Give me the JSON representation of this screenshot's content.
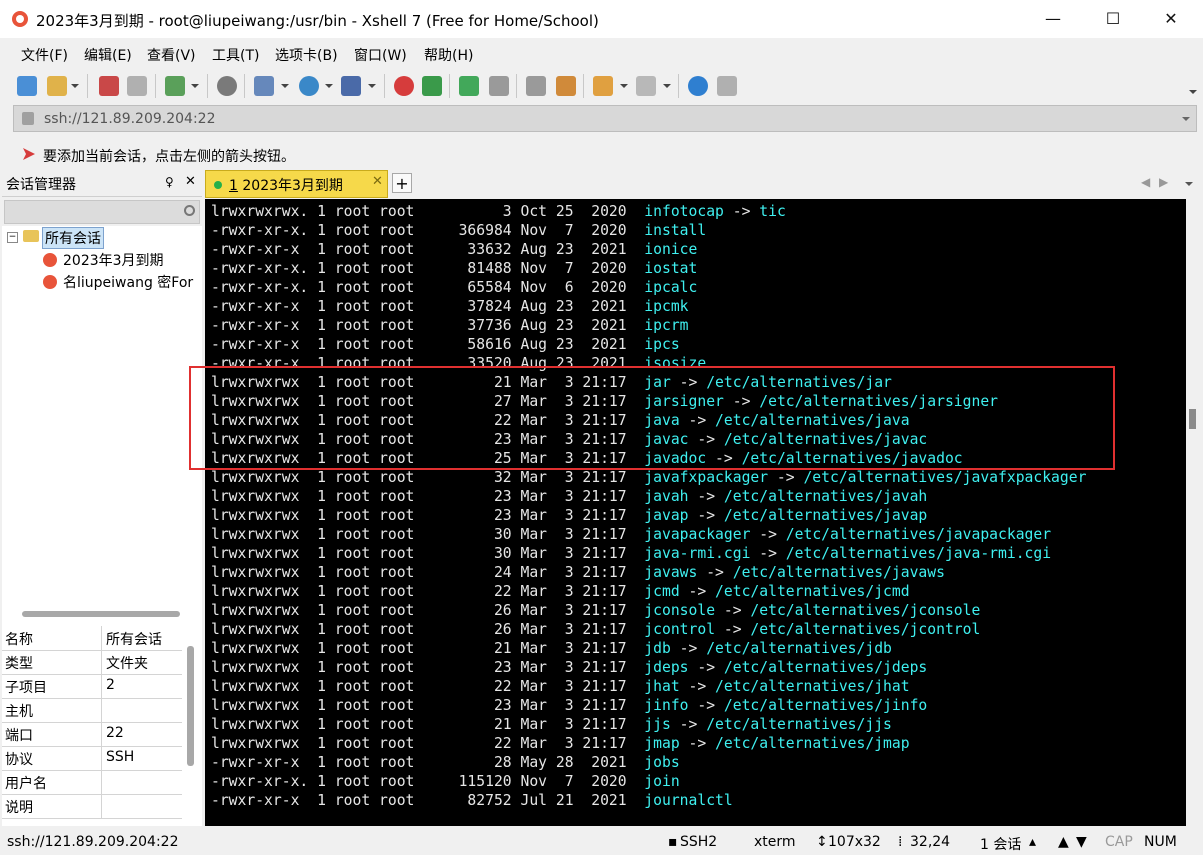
{
  "window": {
    "title": "2023年3月到期 - root@liupeiwang:/usr/bin - Xshell 7 (Free for Home/School)",
    "minimize": "—",
    "maximize": "☐",
    "close": "✕"
  },
  "menu": [
    "文件(F)",
    "编辑(E)",
    "查看(V)",
    "工具(T)",
    "选项卡(B)",
    "窗口(W)",
    "帮助(H)"
  ],
  "address": {
    "value": "ssh://121.89.209.204:22"
  },
  "hint": {
    "text": "要添加当前会话，点击左侧的箭头按钮。"
  },
  "sidebar": {
    "title": "会话管理器",
    "pin": "♀",
    "close": "✕",
    "tree": {
      "root": "所有会话",
      "items": [
        "2023年3月到期",
        "名liupeiwang 密For"
      ]
    },
    "properties": [
      {
        "key": "名称",
        "value": "所有会话"
      },
      {
        "key": "类型",
        "value": "文件夹"
      },
      {
        "key": "子项目",
        "value": "2"
      },
      {
        "key": "主机",
        "value": ""
      },
      {
        "key": "端口",
        "value": "22"
      },
      {
        "key": "协议",
        "value": "SSH"
      },
      {
        "key": "用户名",
        "value": ""
      },
      {
        "key": "说明",
        "value": ""
      }
    ]
  },
  "tabs": [
    {
      "number": "1",
      "label": "2023年3月到期",
      "close": "✕"
    }
  ],
  "terminal": {
    "lines": [
      {
        "perm": "lrwxrwxrwx.",
        "links": "1",
        "owner": "root",
        "group": "root",
        "size": "3",
        "month": "Oct",
        "day": "25",
        "time": " 2020",
        "name": "infotocap",
        "target": "tic"
      },
      {
        "perm": "-rwxr-xr-x.",
        "links": "1",
        "owner": "root",
        "group": "root",
        "size": "366984",
        "month": "Nov",
        "day": "7",
        "time": " 2020",
        "name": "install",
        "target": ""
      },
      {
        "perm": "-rwxr-xr-x ",
        "links": "1",
        "owner": "root",
        "group": "root",
        "size": "33632",
        "month": "Aug",
        "day": "23",
        "time": " 2021",
        "name": "ionice",
        "target": ""
      },
      {
        "perm": "-rwxr-xr-x.",
        "links": "1",
        "owner": "root",
        "group": "root",
        "size": "81488",
        "month": "Nov",
        "day": "7",
        "time": " 2020",
        "name": "iostat",
        "target": ""
      },
      {
        "perm": "-rwxr-xr-x.",
        "links": "1",
        "owner": "root",
        "group": "root",
        "size": "65584",
        "month": "Nov",
        "day": "6",
        "time": " 2020",
        "name": "ipcalc",
        "target": ""
      },
      {
        "perm": "-rwxr-xr-x ",
        "links": "1",
        "owner": "root",
        "group": "root",
        "size": "37824",
        "month": "Aug",
        "day": "23",
        "time": " 2021",
        "name": "ipcmk",
        "target": ""
      },
      {
        "perm": "-rwxr-xr-x ",
        "links": "1",
        "owner": "root",
        "group": "root",
        "size": "37736",
        "month": "Aug",
        "day": "23",
        "time": " 2021",
        "name": "ipcrm",
        "target": ""
      },
      {
        "perm": "-rwxr-xr-x ",
        "links": "1",
        "owner": "root",
        "group": "root",
        "size": "58616",
        "month": "Aug",
        "day": "23",
        "time": " 2021",
        "name": "ipcs",
        "target": ""
      },
      {
        "perm": "-rwxr-xr-x ",
        "links": "1",
        "owner": "root",
        "group": "root",
        "size": "33520",
        "month": "Aug",
        "day": "23",
        "time": " 2021",
        "name": "isosize",
        "target": ""
      },
      {
        "perm": "lrwxrwxrwx ",
        "links": "1",
        "owner": "root",
        "group": "root",
        "size": "21",
        "month": "Mar",
        "day": "3",
        "time": "21:17",
        "name": "jar",
        "target": "/etc/alternatives/jar"
      },
      {
        "perm": "lrwxrwxrwx ",
        "links": "1",
        "owner": "root",
        "group": "root",
        "size": "27",
        "month": "Mar",
        "day": "3",
        "time": "21:17",
        "name": "jarsigner",
        "target": "/etc/alternatives/jarsigner"
      },
      {
        "perm": "lrwxrwxrwx ",
        "links": "1",
        "owner": "root",
        "group": "root",
        "size": "22",
        "month": "Mar",
        "day": "3",
        "time": "21:17",
        "name": "java",
        "target": "/etc/alternatives/java"
      },
      {
        "perm": "lrwxrwxrwx ",
        "links": "1",
        "owner": "root",
        "group": "root",
        "size": "23",
        "month": "Mar",
        "day": "3",
        "time": "21:17",
        "name": "javac",
        "target": "/etc/alternatives/javac"
      },
      {
        "perm": "lrwxrwxrwx ",
        "links": "1",
        "owner": "root",
        "group": "root",
        "size": "25",
        "month": "Mar",
        "day": "3",
        "time": "21:17",
        "name": "javadoc",
        "target": "/etc/alternatives/javadoc"
      },
      {
        "perm": "lrwxrwxrwx ",
        "links": "1",
        "owner": "root",
        "group": "root",
        "size": "32",
        "month": "Mar",
        "day": "3",
        "time": "21:17",
        "name": "javafxpackager",
        "target": "/etc/alternatives/javafxpackager"
      },
      {
        "perm": "lrwxrwxrwx ",
        "links": "1",
        "owner": "root",
        "group": "root",
        "size": "23",
        "month": "Mar",
        "day": "3",
        "time": "21:17",
        "name": "javah",
        "target": "/etc/alternatives/javah"
      },
      {
        "perm": "lrwxrwxrwx ",
        "links": "1",
        "owner": "root",
        "group": "root",
        "size": "23",
        "month": "Mar",
        "day": "3",
        "time": "21:17",
        "name": "javap",
        "target": "/etc/alternatives/javap"
      },
      {
        "perm": "lrwxrwxrwx ",
        "links": "1",
        "owner": "root",
        "group": "root",
        "size": "30",
        "month": "Mar",
        "day": "3",
        "time": "21:17",
        "name": "javapackager",
        "target": "/etc/alternatives/javapackager"
      },
      {
        "perm": "lrwxrwxrwx ",
        "links": "1",
        "owner": "root",
        "group": "root",
        "size": "30",
        "month": "Mar",
        "day": "3",
        "time": "21:17",
        "name": "java-rmi.cgi",
        "target": "/etc/alternatives/java-rmi.cgi"
      },
      {
        "perm": "lrwxrwxrwx ",
        "links": "1",
        "owner": "root",
        "group": "root",
        "size": "24",
        "month": "Mar",
        "day": "3",
        "time": "21:17",
        "name": "javaws",
        "target": "/etc/alternatives/javaws"
      },
      {
        "perm": "lrwxrwxrwx ",
        "links": "1",
        "owner": "root",
        "group": "root",
        "size": "22",
        "month": "Mar",
        "day": "3",
        "time": "21:17",
        "name": "jcmd",
        "target": "/etc/alternatives/jcmd"
      },
      {
        "perm": "lrwxrwxrwx ",
        "links": "1",
        "owner": "root",
        "group": "root",
        "size": "26",
        "month": "Mar",
        "day": "3",
        "time": "21:17",
        "name": "jconsole",
        "target": "/etc/alternatives/jconsole"
      },
      {
        "perm": "lrwxrwxrwx ",
        "links": "1",
        "owner": "root",
        "group": "root",
        "size": "26",
        "month": "Mar",
        "day": "3",
        "time": "21:17",
        "name": "jcontrol",
        "target": "/etc/alternatives/jcontrol"
      },
      {
        "perm": "lrwxrwxrwx ",
        "links": "1",
        "owner": "root",
        "group": "root",
        "size": "21",
        "month": "Mar",
        "day": "3",
        "time": "21:17",
        "name": "jdb",
        "target": "/etc/alternatives/jdb"
      },
      {
        "perm": "lrwxrwxrwx ",
        "links": "1",
        "owner": "root",
        "group": "root",
        "size": "23",
        "month": "Mar",
        "day": "3",
        "time": "21:17",
        "name": "jdeps",
        "target": "/etc/alternatives/jdeps"
      },
      {
        "perm": "lrwxrwxrwx ",
        "links": "1",
        "owner": "root",
        "group": "root",
        "size": "22",
        "month": "Mar",
        "day": "3",
        "time": "21:17",
        "name": "jhat",
        "target": "/etc/alternatives/jhat"
      },
      {
        "perm": "lrwxrwxrwx ",
        "links": "1",
        "owner": "root",
        "group": "root",
        "size": "23",
        "month": "Mar",
        "day": "3",
        "time": "21:17",
        "name": "jinfo",
        "target": "/etc/alternatives/jinfo"
      },
      {
        "perm": "lrwxrwxrwx ",
        "links": "1",
        "owner": "root",
        "group": "root",
        "size": "21",
        "month": "Mar",
        "day": "3",
        "time": "21:17",
        "name": "jjs",
        "target": "/etc/alternatives/jjs"
      },
      {
        "perm": "lrwxrwxrwx ",
        "links": "1",
        "owner": "root",
        "group": "root",
        "size": "22",
        "month": "Mar",
        "day": "3",
        "time": "21:17",
        "name": "jmap",
        "target": "/etc/alternatives/jmap"
      },
      {
        "perm": "-rwxr-xr-x ",
        "links": "1",
        "owner": "root",
        "group": "root",
        "size": "28",
        "month": "May",
        "day": "28",
        "time": " 2021",
        "name": "jobs",
        "target": ""
      },
      {
        "perm": "-rwxr-xr-x.",
        "links": "1",
        "owner": "root",
        "group": "root",
        "size": "115120",
        "month": "Nov",
        "day": "7",
        "time": " 2020",
        "name": "join",
        "target": ""
      },
      {
        "perm": "-rwxr-xr-x ",
        "links": "1",
        "owner": "root",
        "group": "root",
        "size": "82752",
        "month": "Jul",
        "day": "21",
        "time": " 2021",
        "name": "journalctl",
        "target": ""
      }
    ]
  },
  "status": {
    "address": "ssh://121.89.209.204:22",
    "protocol": "SSH2",
    "terminal_type": "xterm",
    "size": "107x32",
    "cursor": "32,24",
    "sessions": "1 会话",
    "caps": "CAP",
    "num": "NUM"
  },
  "colors": {
    "highlight_box": "#e03030",
    "tab_active": "#f6d94a",
    "terminal_bg": "#000000",
    "terminal_name": "#3ff0f0"
  }
}
